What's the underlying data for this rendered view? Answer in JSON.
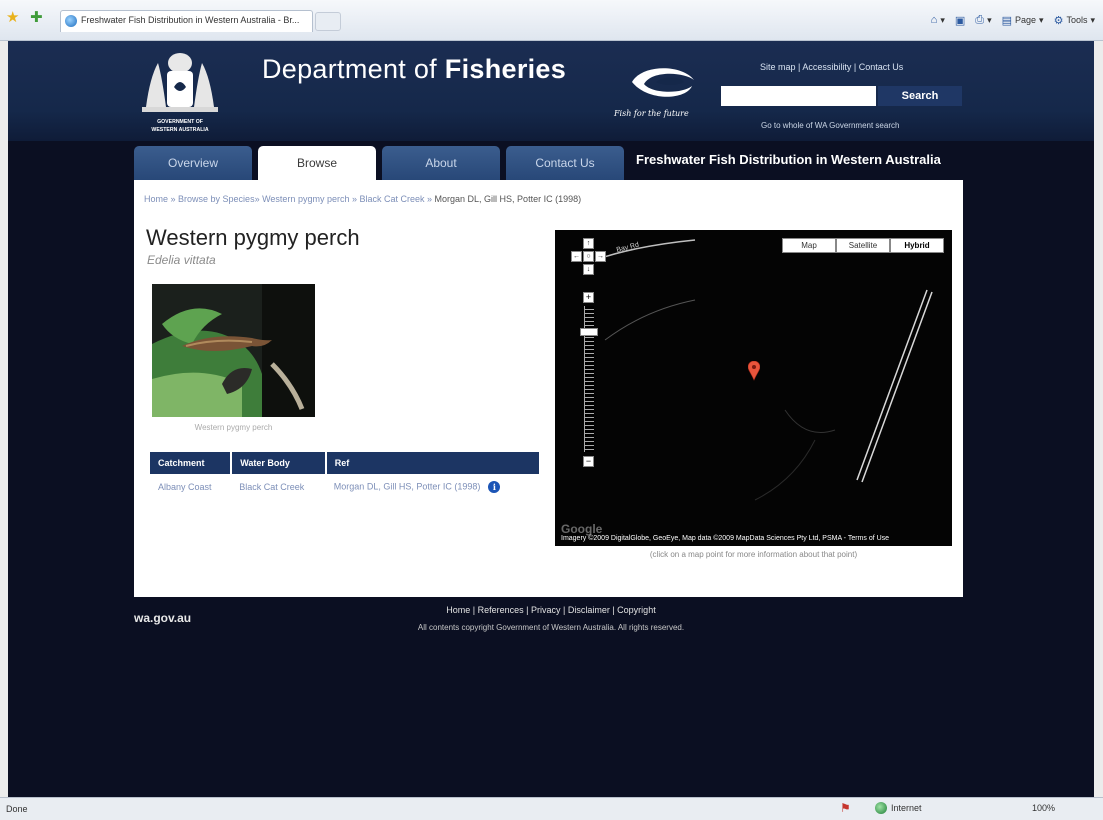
{
  "browser": {
    "tab_title": "Freshwater Fish Distribution in Western Australia - Br...",
    "commands": {
      "page": "Page",
      "tools": "Tools"
    },
    "status_text": "Done",
    "zone": "Internet",
    "zoom": "100%"
  },
  "header": {
    "crest_label": "GOVERNMENT OF WESTERN AUSTRALIA",
    "dept_prefix": "Department of ",
    "dept_bold": "Fisheries",
    "tagline": "Fish for the future",
    "utility_links": "Site map | Accessibility | Contact Us",
    "search_placeholder": "",
    "search_button": "Search",
    "wa_search": "Go to whole of WA Government search"
  },
  "nav": {
    "tabs": [
      {
        "label": "Overview",
        "active": false
      },
      {
        "label": "Browse",
        "active": true
      },
      {
        "label": "About",
        "active": false
      },
      {
        "label": "Contact Us",
        "active": false
      }
    ],
    "site_title": "Freshwater Fish Distribution in Western Australia"
  },
  "breadcrumb": {
    "home": "Home",
    "browse": "Browse by Species",
    "species": "Western pygmy perch",
    "water": "Black Cat Creek",
    "current": "Morgan DL, Gill HS, Potter IC (1998)"
  },
  "species": {
    "common_name": "Western pygmy perch",
    "scientific_name": "Edelia vittata",
    "photo_caption": "Western pygmy perch"
  },
  "table": {
    "headers": [
      "Catchment",
      "Water Body",
      "Ref"
    ],
    "rows": [
      [
        "Albany Coast",
        "Black Cat Creek",
        "Morgan DL, Gill HS, Potter IC (1998)"
      ]
    ]
  },
  "map": {
    "types": [
      "Map",
      "Satellite",
      "Hybrid"
    ],
    "selected_type": "Hybrid",
    "road_label": "Bay Rd",
    "google": "Google",
    "attribution": "Imagery ©2009 DigitalGlobe, GeoEye, Map data ©2009 MapData Sciences Pty Ltd, PSMA - Terms of Use",
    "hint": "(click on a map point for more information about that point)"
  },
  "footer": {
    "logo": "wa.gov.au",
    "links": "Home | References | Privacy | Disclaimer | Copyright",
    "copyright": "All contents copyright Government of Western Australia. All rights reserved."
  },
  "colors": {
    "header_bg": "#15284a",
    "page_bg": "#0b0f22",
    "table_header": "#1c3563",
    "marker": "#e8553c"
  }
}
